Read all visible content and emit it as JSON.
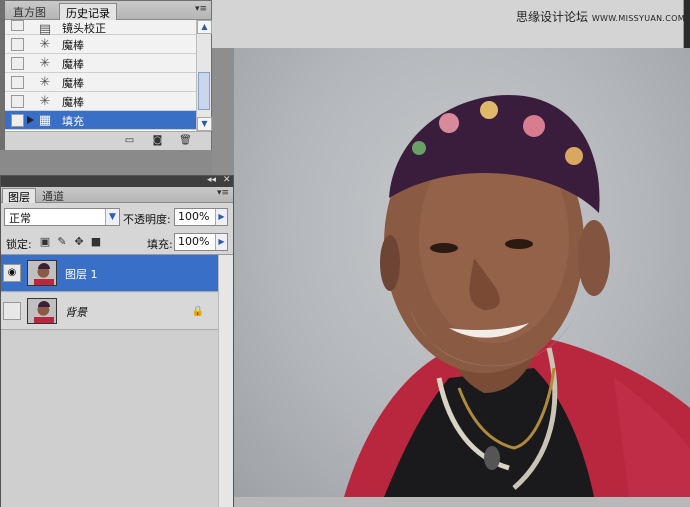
{
  "watermark": {
    "text": "思缘设计论坛",
    "url": "WWW.MISSYUAN.COM"
  },
  "history_panel": {
    "tabs": [
      {
        "label": "直方图",
        "active": false
      },
      {
        "label": "历史记录",
        "active": true
      }
    ],
    "menu_glyph": "▾≡",
    "items": [
      {
        "label": "镜头校正",
        "icon": "filter-icon",
        "selected": false
      },
      {
        "label": "魔棒",
        "icon": "magic-wand-icon",
        "selected": false
      },
      {
        "label": "魔棒",
        "icon": "magic-wand-icon",
        "selected": false
      },
      {
        "label": "魔棒",
        "icon": "magic-wand-icon",
        "selected": false
      },
      {
        "label": "魔棒",
        "icon": "magic-wand-icon",
        "selected": false
      },
      {
        "label": "填充",
        "icon": "fill-icon",
        "selected": true
      }
    ]
  },
  "layers_panel": {
    "titlebar_glyphs": {
      "collapse": "◂◂",
      "close": "✕"
    },
    "menu_glyph": "▾≡",
    "tabs": [
      {
        "label": "图层",
        "active": true
      },
      {
        "label": "通道",
        "active": false
      }
    ],
    "blend_mode": "正常",
    "opacity_label": "不透明度:",
    "opacity_value": "100%",
    "lock_label": "锁定:",
    "fill_label": "填充:",
    "fill_value": "100%",
    "layers": [
      {
        "name": "图层 1",
        "visible": true,
        "selected": true,
        "locked": false
      },
      {
        "name": "背景",
        "visible": false,
        "selected": false,
        "locked": true
      }
    ]
  },
  "colors": {
    "selection": "#3a6fc8",
    "panel_bg": "#d6d6d6",
    "shirt_red": "#b8273e"
  }
}
